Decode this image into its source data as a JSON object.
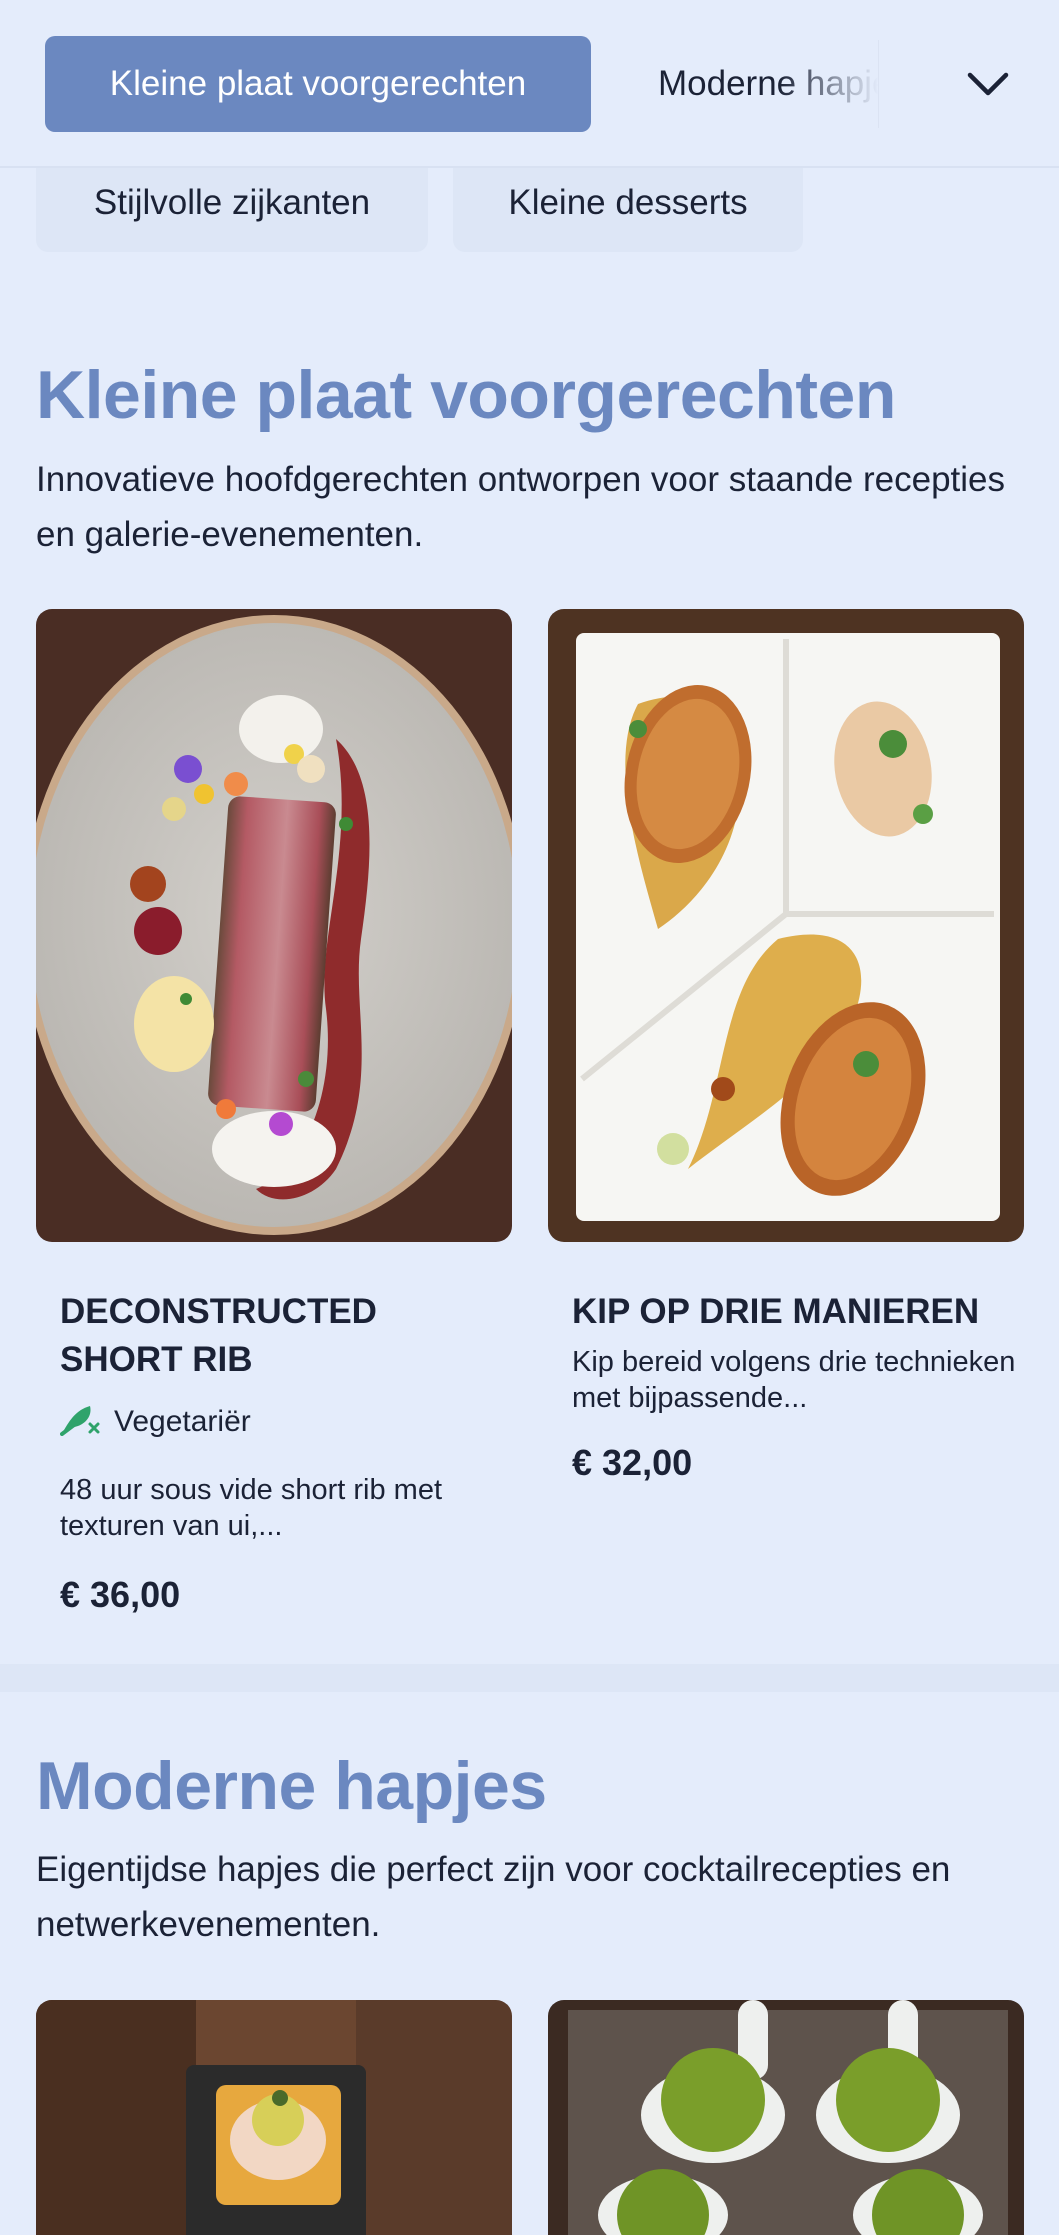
{
  "nav": {
    "active_label": "Kleine plaat voorgerechten",
    "next_label": "Moderne hapjes",
    "row2": [
      "Stijlvolle zijkanten",
      "Kleine desserts"
    ],
    "expand_icon": "chevron-down-icon"
  },
  "sections": [
    {
      "title": "Kleine plaat voorgerechten",
      "description": "Innovatieve hoofdgerechten ontworpen voor staande recepties en galerie-evenementen.",
      "dishes": [
        {
          "name": "Deconstructed Short Rib",
          "tag": "Vegetariër",
          "tag_icon": "vegetarian-leaf-icon",
          "description": "48 uur sous vide short rib met texturen van ui,...",
          "price": "€ 36,00"
        },
        {
          "name": "Kip op drie manieren",
          "description": "Kip bereid volgens drie technieken met bijpassende...",
          "price": "€ 32,00"
        }
      ]
    },
    {
      "title": "Moderne hapjes",
      "description": "Eigentijdse hapjes die perfect zijn voor cocktailrecepties en netwerkevenementen."
    }
  ],
  "colors": {
    "background": "#e4ecfb",
    "accent": "#6b88c0",
    "text": "#1b2236",
    "tag_green": "#2fa36b"
  }
}
